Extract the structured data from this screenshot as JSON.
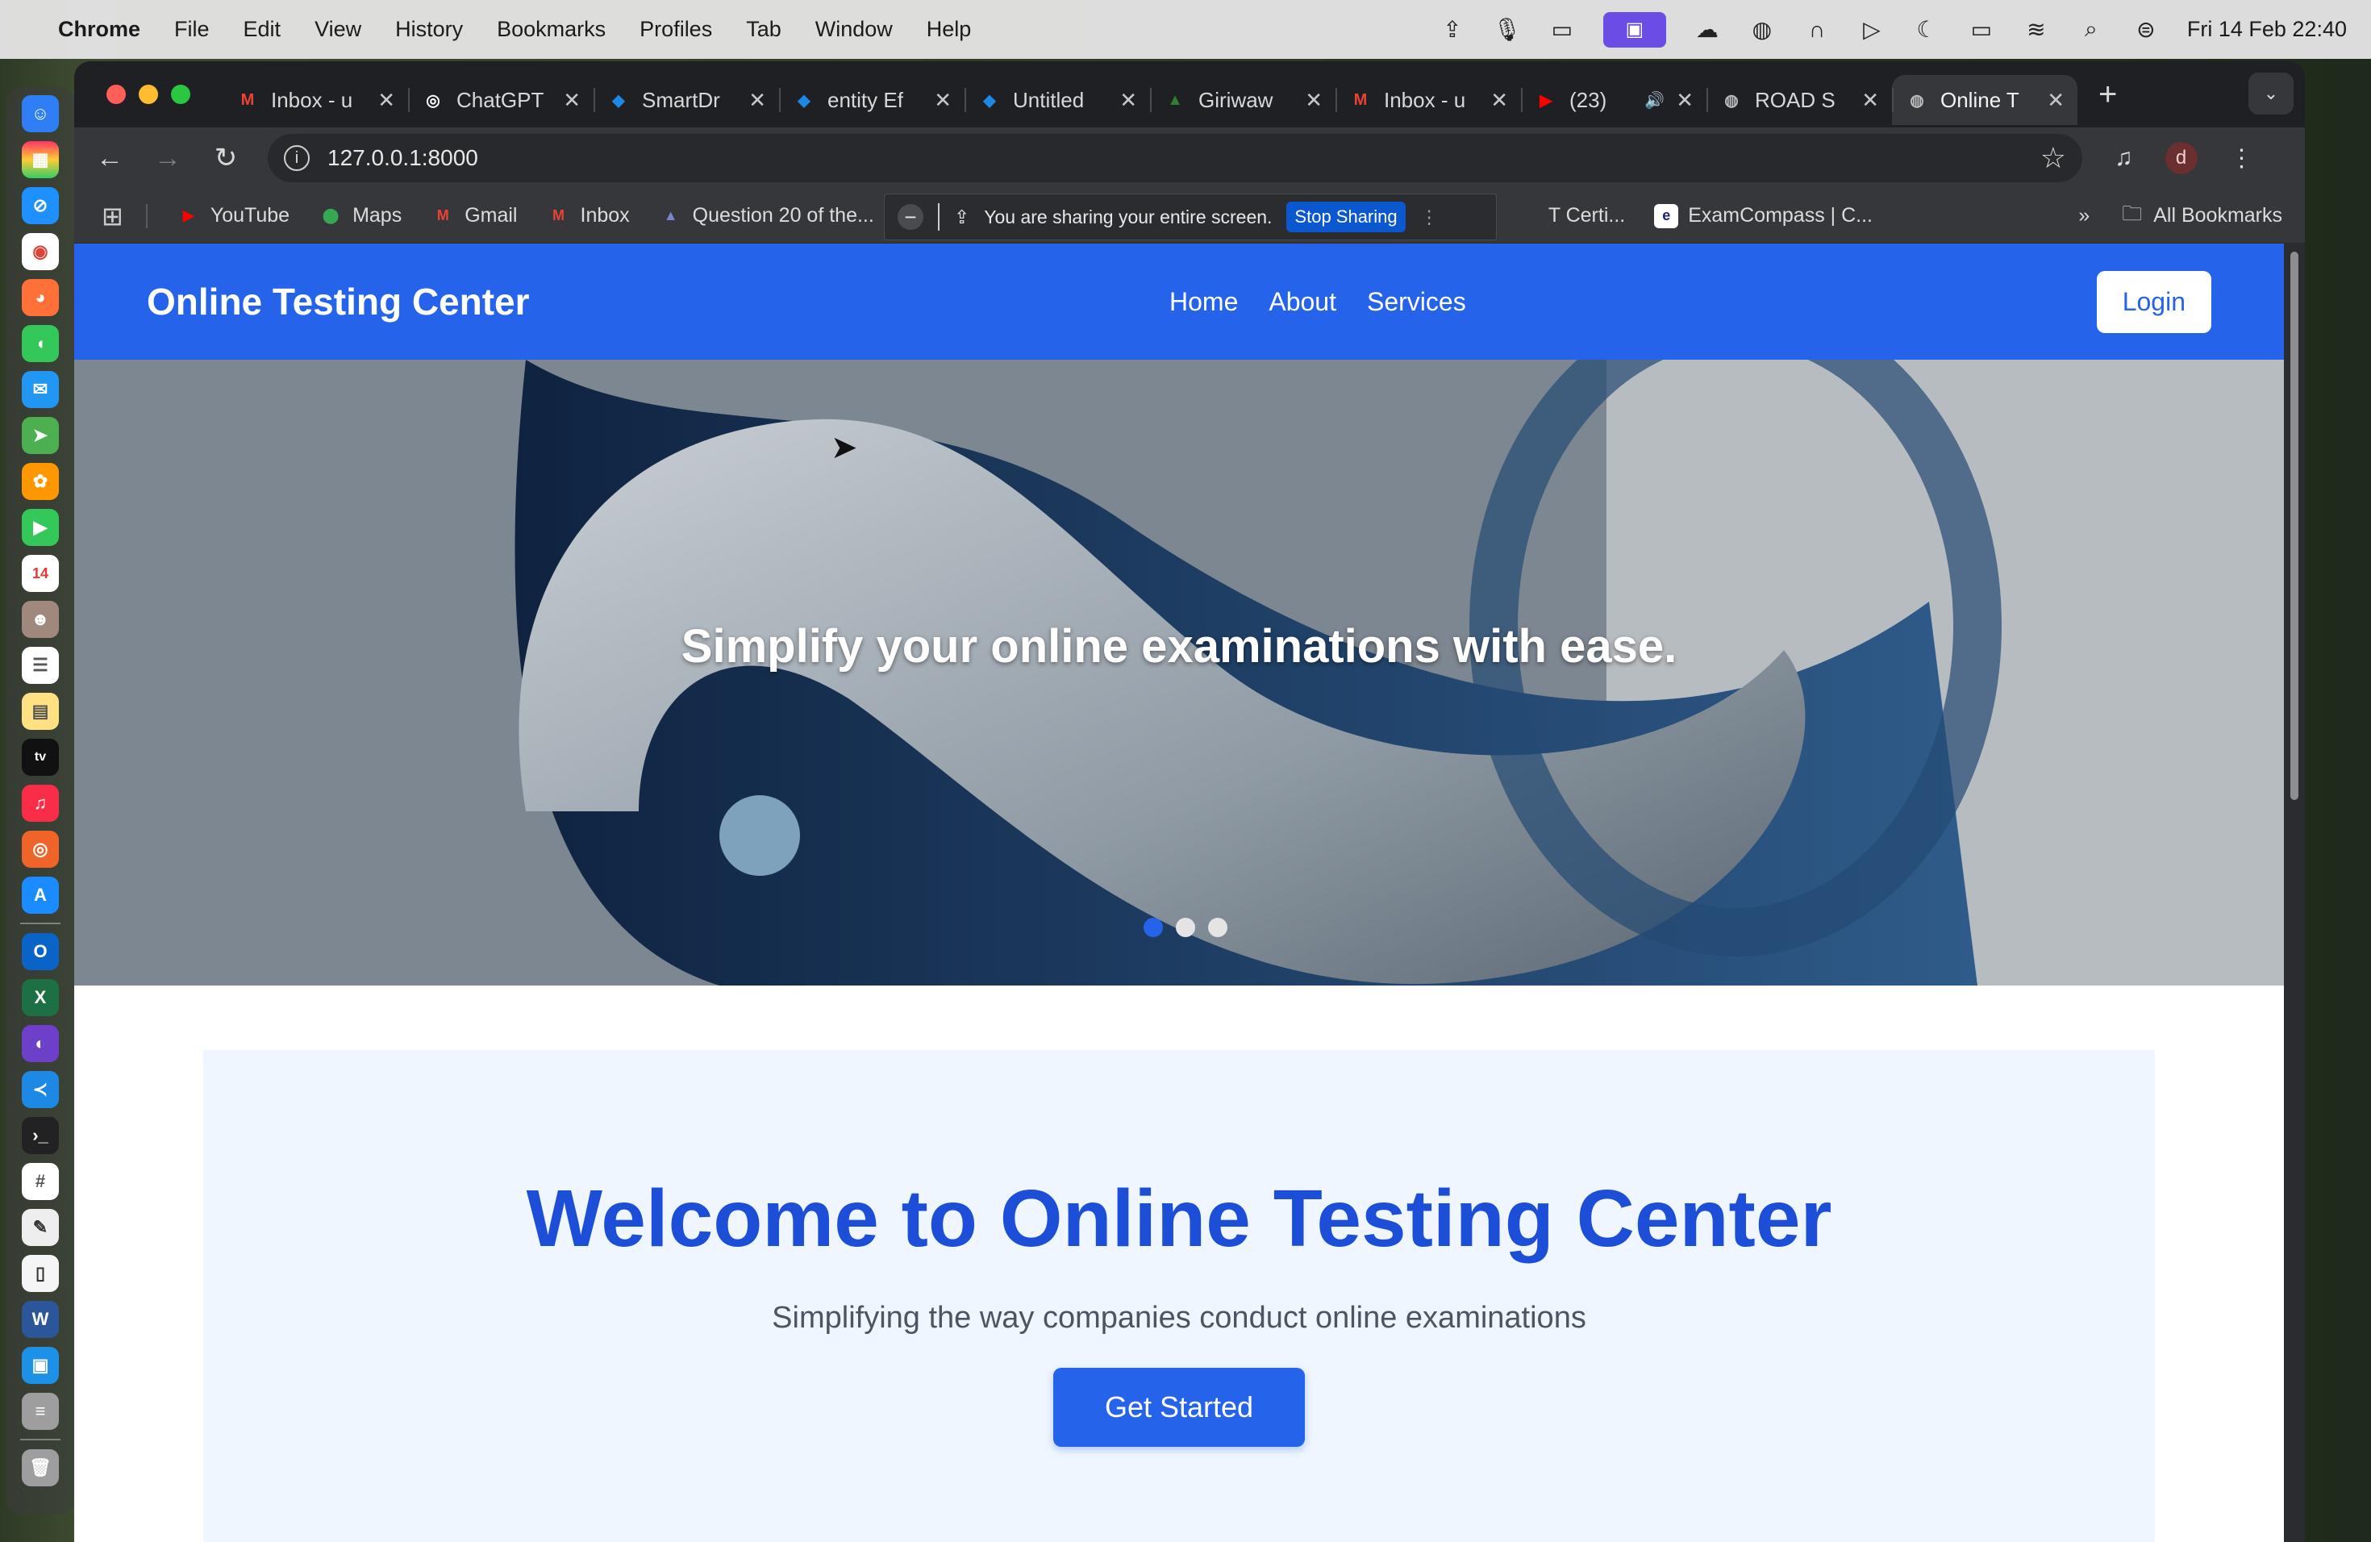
{
  "menubar": {
    "app_name": "Chrome",
    "menus": [
      "File",
      "Edit",
      "View",
      "History",
      "Bookmarks",
      "Profiles",
      "Tab",
      "Window",
      "Help"
    ],
    "clock": "Fri 14 Feb  22:40"
  },
  "tabs": [
    {
      "title": "Inbox - u",
      "icon": "gmail-icon",
      "color": "#ea4335",
      "glyph": "M"
    },
    {
      "title": "ChatGPT",
      "icon": "chatgpt-icon",
      "color": "#ffffff",
      "glyph": "◎"
    },
    {
      "title": "SmartDr",
      "icon": "smartdraw-icon",
      "color": "#1e88e5",
      "glyph": "◆"
    },
    {
      "title": "entity Ef",
      "icon": "smartdraw-icon",
      "color": "#1e88e5",
      "glyph": "◆"
    },
    {
      "title": "Untitled",
      "icon": "smartdraw-icon",
      "color": "#1e88e5",
      "glyph": "◆"
    },
    {
      "title": "Giriwaw",
      "icon": "alltrails-icon",
      "color": "#2e7d32",
      "glyph": "▲"
    },
    {
      "title": "Inbox - u",
      "icon": "gmail-icon",
      "color": "#ea4335",
      "glyph": "M"
    },
    {
      "title": "(23)",
      "icon": "youtube-icon",
      "color": "#ff0000",
      "glyph": "▶"
    },
    {
      "title": "ROAD S",
      "icon": "globe-icon",
      "color": "#bbbbbb",
      "glyph": "◍"
    },
    {
      "title": "Online T",
      "icon": "globe-icon",
      "color": "#bbbbbb",
      "glyph": "◍",
      "active": true
    }
  ],
  "address_bar": {
    "url": "127.0.0.1:8000"
  },
  "bookmarks": [
    {
      "label": "YouTube",
      "icon": "youtube-icon",
      "color": "#ff0000",
      "glyph": "▶"
    },
    {
      "label": "Maps",
      "icon": "maps-icon",
      "color": "#34a853",
      "glyph": "⬤"
    },
    {
      "label": "Gmail",
      "icon": "gmail-icon",
      "color": "#ea4335",
      "glyph": "M"
    },
    {
      "label": "Inbox",
      "icon": "gmail-icon",
      "color": "#ea4335",
      "glyph": "M"
    },
    {
      "label": "Question 20 of the...",
      "icon": "mountain-icon",
      "color": "#7986cb",
      "glyph": "▲"
    }
  ],
  "bookmarks_after_banner": [
    {
      "label": "T Certi..."
    },
    {
      "label": "ExamCompass | C...",
      "icon": "examcompass-icon",
      "color": "#ffffff",
      "glyph": "e"
    }
  ],
  "all_bookmarks": "All Bookmarks",
  "share_banner": {
    "message": "You are sharing your entire screen.",
    "stop_label": "Stop Sharing"
  },
  "site": {
    "brand": "Online Testing Center",
    "nav_links": [
      "Home",
      "About",
      "Services"
    ],
    "login_label": "Login",
    "hero_caption": "Simplify your online examinations with ease.",
    "carousel": {
      "slides": 3,
      "active_index": 0
    },
    "welcome_title": "Welcome to Online Testing Center",
    "welcome_subtitle": "Simplifying the way companies conduct online examinations",
    "cta_label": "Get Started"
  },
  "colors": {
    "primary": "#2563eb",
    "heading": "#1d4ed8",
    "welcome_bg": "#eff6ff"
  }
}
